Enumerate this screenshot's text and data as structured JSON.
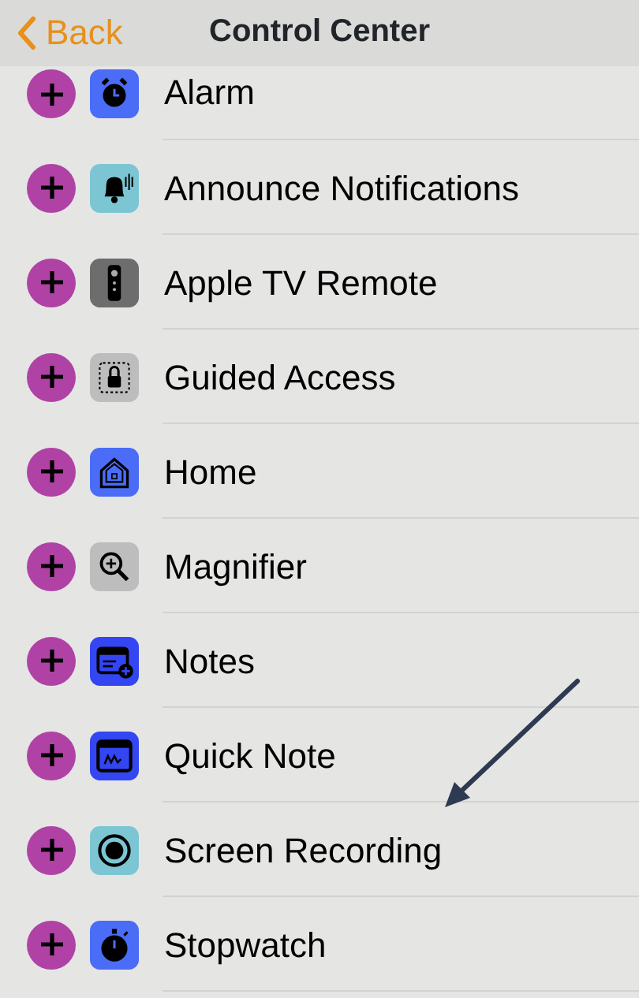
{
  "nav_bar": {
    "back_label": "Back",
    "title": "Control Center"
  },
  "items": [
    {
      "label": "Alarm",
      "color": "#4a6cf7"
    },
    {
      "label": "Announce Notifications",
      "color": "#7cc6d4"
    },
    {
      "label": "Apple TV Remote",
      "color": "#6d6d6d"
    },
    {
      "label": "Guided Access",
      "color": "#bdbdbd"
    },
    {
      "label": "Home",
      "color": "#4a6cf7"
    },
    {
      "label": "Magnifier",
      "color": "#bdbdbd"
    },
    {
      "label": "Notes",
      "color": "#3346f2"
    },
    {
      "label": "Quick Note",
      "color": "#3346f2"
    },
    {
      "label": "Screen Recording",
      "color": "#7cc6d4"
    },
    {
      "label": "Stopwatch",
      "color": "#4a6cf7"
    }
  ]
}
